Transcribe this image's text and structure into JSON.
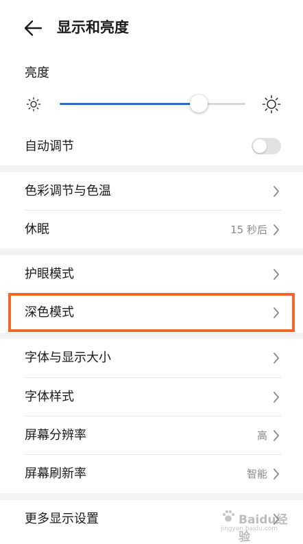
{
  "header": {
    "title": "显示和亮度"
  },
  "brightness": {
    "label": "亮度",
    "level_fraction": 0.75
  },
  "auto_adjust": {
    "label": "自动调节",
    "enabled": false
  },
  "rows": [
    {
      "label": "色彩调节与色温",
      "value": ""
    },
    {
      "label": "休眠",
      "value": "15 秒后"
    },
    {
      "label": "护眼模式",
      "value": ""
    },
    {
      "label": "深色模式",
      "value": ""
    },
    {
      "label": "字体与显示大小",
      "value": ""
    },
    {
      "label": "字体样式",
      "value": ""
    },
    {
      "label": "屏幕分辨率",
      "value": "高"
    },
    {
      "label": "屏幕刷新率",
      "value": "智能"
    },
    {
      "label": "更多显示设置",
      "value": ""
    }
  ],
  "highlighted_row": "深色模式",
  "watermark": {
    "text": "Baidu经验",
    "url": "jingyan.baidu.com"
  },
  "colors": {
    "accent": "#1f6fd6",
    "highlight": "#f06a2e",
    "section_gap": "#f1f3f5"
  }
}
